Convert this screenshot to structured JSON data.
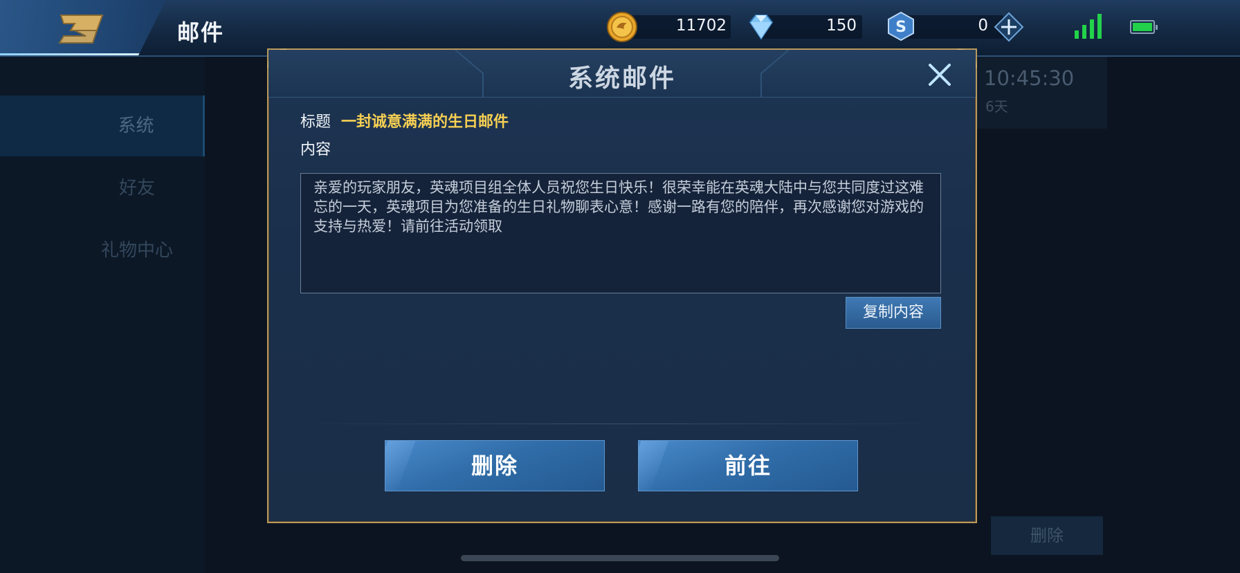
{
  "header": {
    "title": "邮件",
    "back_icon": "back-arrow-icon",
    "currencies": [
      {
        "icon": "gold-coin-icon",
        "value": "11702"
      },
      {
        "icon": "diamond-icon",
        "value": "150"
      },
      {
        "icon": "s-coupon-icon",
        "value": "0"
      }
    ],
    "add_icon": "plus-icon",
    "status": {
      "signal_icon": "signal-icon",
      "battery_icon": "battery-icon"
    }
  },
  "sidebar": {
    "items": [
      {
        "label": "系统",
        "active": true
      },
      {
        "label": "好友",
        "active": false
      },
      {
        "label": "礼物中心",
        "active": false
      }
    ]
  },
  "background_mail": {
    "time": "10:45:30",
    "days": "6天",
    "delete_label": "删除"
  },
  "modal": {
    "title": "系统邮件",
    "subject_label": "标题",
    "subject_value": "一封诚意满满的生日邮件",
    "content_label": "内容",
    "content_text": "亲爱的玩家朋友，英魂项目组全体人员祝您生日快乐！很荣幸能在英魂大陆中与您共同度过这难忘的一天，英魂项目为您准备的生日礼物聊表心意！感谢一路有您的陪伴，再次感谢您对游戏的支持与热爱！请前往活动领取",
    "copy_label": "复制内容",
    "delete_label": "删除",
    "goto_label": "前往",
    "close_icon": "close-icon"
  },
  "colors": {
    "accent_gold": "#f6cf53",
    "modal_border": "#bb9a5b",
    "button_blue": "#306da9",
    "signal_green": "#23d24b"
  }
}
